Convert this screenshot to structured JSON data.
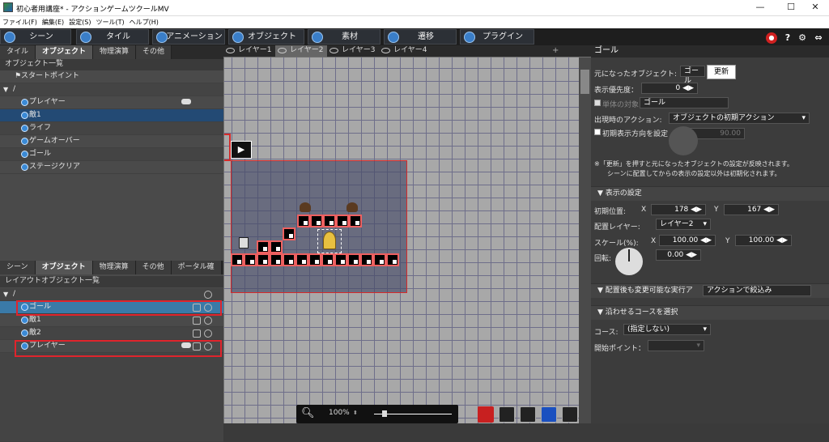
{
  "window": {
    "title": "初心者用講座* - アクションゲームツクールMV",
    "minimize": "—",
    "maximize": "☐",
    "close": "✕"
  },
  "menu": [
    "ファイル(F)",
    "編集(E)",
    "設定(S)",
    "ツール(T)",
    "ヘルプ(H)"
  ],
  "toolbar": {
    "buttons": [
      "シーン",
      "タイル",
      "アニメーション",
      "オブジェクト",
      "素材",
      "遷移",
      "プラグイン"
    ],
    "help": "?"
  },
  "left_top": {
    "tabs": [
      "タイル",
      "オブジェクト",
      "物理演算",
      "その他"
    ],
    "list_title": "オブジェクト一覧",
    "start_point": "スタートポイント",
    "folder": "/",
    "items": [
      "プレイヤー",
      "敵1",
      "ライフ",
      "ゲームオーバー",
      "ゴール",
      "ステージクリア"
    ]
  },
  "left_bottom": {
    "tabs": [
      "シーン",
      "オブジェクト",
      "物理演算",
      "その他",
      "ポータル確"
    ],
    "list_title": "レイアウトオブジェクト一覧",
    "folder": "/",
    "items": [
      "ゴール",
      "敵1",
      "敵2",
      "プレイヤー"
    ]
  },
  "layers": [
    "レイヤー1",
    "レイヤー2",
    "レイヤー3",
    "レイヤー4"
  ],
  "zoom": "100%",
  "right": {
    "title": "ゴール",
    "base_object_label": "元になったオブジェクト:",
    "base_object_value": "ゴール",
    "update_button": "更新",
    "priority_label": "表示優先度：",
    "priority_value": "0",
    "single_target_label": "単体の対象",
    "single_target_value": "ゴール",
    "spawn_action_label": "出現時のアクション:",
    "spawn_action_value": "オブジェクトの初期アクション",
    "init_dir_label": "初期表示方向を設定",
    "init_dir_value": "90.00",
    "note1": "※「更新」を押すと元になったオブジェクトの設定が反映されます。",
    "note2": "シーンに配置してからの表示の設定以外は初期化されます。",
    "display_section": "表示の設定",
    "init_pos_label": "初期位置:",
    "x_label": "X",
    "x_value": "178",
    "y_label": "Y",
    "y_value": "167",
    "layer_label": "配置レイヤー:",
    "layer_value": "レイヤー2",
    "scale_label": "スケール(%):",
    "scale_x": "100.00",
    "scale_y": "100.00",
    "rotation_label": "回転:",
    "rotation_value": "0.00",
    "exec_section": "配置後も変更可能な実行ア",
    "exec_filter": "アクションで絞込み",
    "course_section": "沿わせるコースを選択",
    "course_label": "コース:",
    "course_value": "(指定しない)",
    "start_point_label": "開始ポイント："
  }
}
